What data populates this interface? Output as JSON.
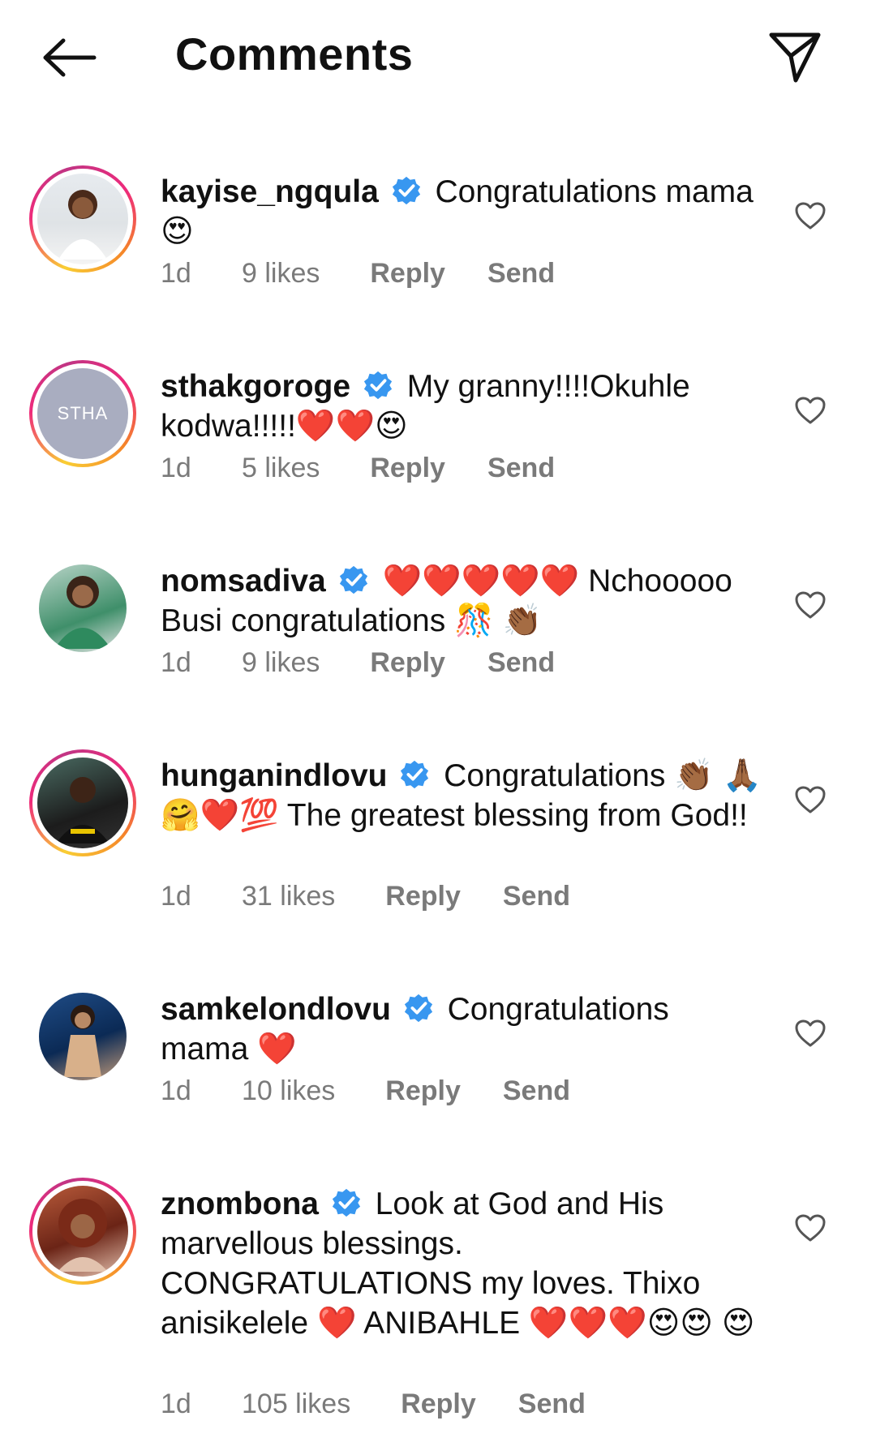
{
  "header": {
    "title": "Comments",
    "back_icon": "arrow-left-icon",
    "share_icon": "paper-plane-icon"
  },
  "comments": [
    {
      "username": "kayise_ngqula",
      "verified": true,
      "text": "Congratulations mama 😍",
      "time": "1d",
      "likes": "9 likes",
      "reply": "Reply",
      "send": "Send"
    },
    {
      "username": "sthakgoroge",
      "avatar_text": "STHA",
      "verified": true,
      "text": "My granny!!!!Okuhle kodwa!!!!!❤️❤️😍",
      "time": "1d",
      "likes": "5 likes",
      "reply": "Reply",
      "send": "Send"
    },
    {
      "username": "nomsadiva",
      "verified": true,
      "text": "❤️❤️❤️❤️❤️ Nchooooo Busi congratulations 🎊 👏🏾",
      "time": "1d",
      "likes": "9 likes",
      "reply": "Reply",
      "send": "Send"
    },
    {
      "username": "hunganindlovu",
      "verified": true,
      "text": "Congratulations 👏🏾 🙏🏾🤗❤️💯 The greatest blessing from God!!",
      "time": "1d",
      "likes": "31 likes",
      "reply": "Reply",
      "send": "Send"
    },
    {
      "username": "samkelondlovu",
      "verified": true,
      "text": "Congratulations mama ❤️",
      "time": "1d",
      "likes": "10 likes",
      "reply": "Reply",
      "send": "Send"
    },
    {
      "username": "znombona",
      "verified": true,
      "text": "Look at God and His marvellous blessings. CONGRATULATIONS my loves. Thixo anisikelele ❤️ ANIBAHLE ❤️❤️❤️😍😍 😍",
      "time": "1d",
      "likes": "105 likes",
      "reply": "Reply",
      "send": "Send"
    }
  ],
  "colors": {
    "meta_gray": "#7a7a7a",
    "verified_blue": "#3897f0",
    "heart_red": "#e0162b",
    "story_ring_start": "#f9ce34",
    "story_ring_mid": "#ee2a7b",
    "story_ring_end": "#c13584"
  }
}
